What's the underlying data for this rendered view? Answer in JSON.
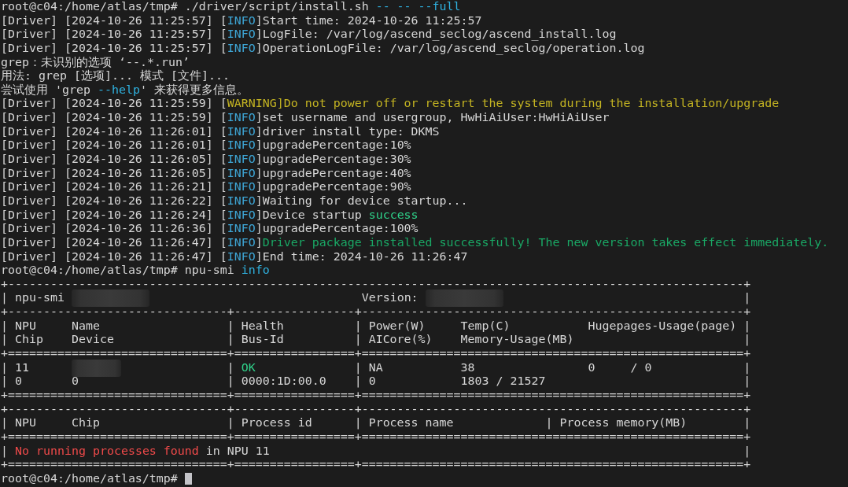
{
  "terminal": {
    "lines": [
      {
        "kind": "prompt",
        "segments": [
          {
            "text": "root@c04:/home/atlas/tmp# ./driver/script/install.sh "
          },
          {
            "kind": "option",
            "text": "-- -- --full"
          }
        ]
      },
      {
        "kind": "log",
        "segments": [
          {
            "text": "[Driver] [2024-10-26 11:25:57] ["
          },
          {
            "kind": "info",
            "text": "INFO"
          },
          {
            "text": "]Start time: 2024-10-26 11:25:57"
          }
        ]
      },
      {
        "kind": "log",
        "segments": [
          {
            "text": "[Driver] [2024-10-26 11:25:57] ["
          },
          {
            "kind": "info",
            "text": "INFO"
          },
          {
            "text": "]LogFile: /var/log/ascend_seclog/ascend_install.log"
          }
        ]
      },
      {
        "kind": "log",
        "segments": [
          {
            "text": "[Driver] [2024-10-26 11:25:57] ["
          },
          {
            "kind": "info",
            "text": "INFO"
          },
          {
            "text": "]OperationLogFile: /var/log/ascend_seclog/operation.log"
          }
        ]
      },
      {
        "kind": "message",
        "segments": [
          {
            "text": "grep：未识别的选项 ‘--.*.run’"
          }
        ]
      },
      {
        "kind": "message",
        "segments": [
          {
            "text": "用法: grep [选项]... 模式 [文件]..."
          }
        ]
      },
      {
        "kind": "message",
        "segments": [
          {
            "text": "尝试使用 'grep "
          },
          {
            "kind": "option",
            "text": "--help"
          },
          {
            "text": "' 来获得更多信息。"
          }
        ]
      },
      {
        "kind": "log",
        "segments": [
          {
            "text": "[Driver] [2024-10-26 11:25:59] ["
          },
          {
            "kind": "warning",
            "text": "WARNING]Do not power off or restart the system during the installation/upgrade"
          }
        ]
      },
      {
        "kind": "log",
        "segments": [
          {
            "text": "[Driver] [2024-10-26 11:25:59] ["
          },
          {
            "kind": "info",
            "text": "INFO"
          },
          {
            "text": "]set username and usergroup, HwHiAiUser:HwHiAiUser"
          }
        ]
      },
      {
        "kind": "log",
        "segments": [
          {
            "text": "[Driver] [2024-10-26 11:26:01] ["
          },
          {
            "kind": "info",
            "text": "INFO"
          },
          {
            "text": "]driver install type: DKMS"
          }
        ]
      },
      {
        "kind": "log",
        "segments": [
          {
            "text": "[Driver] [2024-10-26 11:26:01] ["
          },
          {
            "kind": "info",
            "text": "INFO"
          },
          {
            "text": "]upgradePercentage:10%"
          }
        ]
      },
      {
        "kind": "log",
        "segments": [
          {
            "text": "[Driver] [2024-10-26 11:26:05] ["
          },
          {
            "kind": "info",
            "text": "INFO"
          },
          {
            "text": "]upgradePercentage:30%"
          }
        ]
      },
      {
        "kind": "log",
        "segments": [
          {
            "text": "[Driver] [2024-10-26 11:26:05] ["
          },
          {
            "kind": "info",
            "text": "INFO"
          },
          {
            "text": "]upgradePercentage:40%"
          }
        ]
      },
      {
        "kind": "log",
        "segments": [
          {
            "text": "[Driver] [2024-10-26 11:26:21] ["
          },
          {
            "kind": "info",
            "text": "INFO"
          },
          {
            "text": "]upgradePercentage:90%"
          }
        ]
      },
      {
        "kind": "log",
        "segments": [
          {
            "text": "[Driver] [2024-10-26 11:26:22] ["
          },
          {
            "kind": "info",
            "text": "INFO"
          },
          {
            "text": "]Waiting for device startup..."
          }
        ]
      },
      {
        "kind": "log",
        "segments": [
          {
            "text": "[Driver] [2024-10-26 11:26:24] ["
          },
          {
            "kind": "info",
            "text": "INFO"
          },
          {
            "text": "]Device startup "
          },
          {
            "kind": "ok",
            "text": "success"
          }
        ]
      },
      {
        "kind": "log",
        "segments": [
          {
            "text": "[Driver] [2024-10-26 11:26:36] ["
          },
          {
            "kind": "info",
            "text": "INFO"
          },
          {
            "text": "]upgradePercentage:100%"
          }
        ]
      },
      {
        "kind": "log",
        "segments": [
          {
            "text": "[Driver] [2024-10-26 11:26:47] ["
          },
          {
            "kind": "info",
            "text": "INFO"
          },
          {
            "text": "]"
          },
          {
            "kind": "done",
            "text": "Driver package installed successfully! The new version takes effect immediately."
          }
        ]
      },
      {
        "kind": "log",
        "segments": [
          {
            "text": "[Driver] [2024-10-26 11:26:47] ["
          },
          {
            "kind": "info",
            "text": "INFO"
          },
          {
            "text": "]End time: 2024-10-26 11:26:47"
          }
        ]
      },
      {
        "kind": "prompt",
        "segments": [
          {
            "text": "root@c04:/home/atlas/tmp# npu-smi "
          },
          {
            "kind": "option",
            "text": "info"
          }
        ]
      },
      {
        "kind": "border",
        "segments": [
          {
            "text": "+--------------------------------------------------------------------------------------------------------+"
          }
        ]
      },
      {
        "kind": "banner",
        "segments": [
          {
            "text": "| npu-smi "
          },
          {
            "kind": "redacted"
          },
          {
            "text": "                              Version: "
          },
          {
            "kind": "redacted"
          },
          {
            "text": "                                  |"
          }
        ]
      },
      {
        "kind": "border",
        "segments": [
          {
            "text": "+-------------------------------+-----------------+------------------------------------------------------+"
          }
        ]
      },
      {
        "kind": "row",
        "segments": [
          {
            "text": "| NPU     Name                  | Health          | Power(W)     Temp(C)           Hugepages-Usage(page) |"
          }
        ]
      },
      {
        "kind": "row",
        "segments": [
          {
            "text": "| Chip    Device                | Bus-Id          | AICore(%)    Memory-Usage(MB)                        |"
          }
        ]
      },
      {
        "kind": "border",
        "segments": [
          {
            "text": "+===============================+=================+======================================================+"
          }
        ]
      },
      {
        "kind": "row",
        "segments": [
          {
            "text": "| 11      "
          },
          {
            "kind": "redacted"
          },
          {
            "text": "               | "
          },
          {
            "kind": "ok",
            "text": "OK"
          },
          {
            "text": "              | NA           38                0     / 0             |"
          }
        ]
      },
      {
        "kind": "row",
        "segments": [
          {
            "text": "| 0       0                     | 0000:1D:00.0    | 0            1803 / 21527                            |"
          }
        ]
      },
      {
        "kind": "border",
        "segments": [
          {
            "text": "+===============================+=================+======================================================+"
          }
        ]
      },
      {
        "kind": "border",
        "segments": [
          {
            "text": "+-------------------------------+-----------------+------------------------------------------------------+"
          }
        ]
      },
      {
        "kind": "row",
        "segments": [
          {
            "text": "| NPU     Chip                  | Process id      | Process name             | Process memory(MB)        |"
          }
        ]
      },
      {
        "kind": "border",
        "segments": [
          {
            "text": "+===============================+=================+======================================================+"
          }
        ]
      },
      {
        "kind": "row",
        "segments": [
          {
            "text": "| "
          },
          {
            "kind": "error",
            "text": "No running processes found"
          },
          {
            "text": " in NPU 11                                                                   |"
          }
        ]
      },
      {
        "kind": "border",
        "segments": [
          {
            "text": "+===============================+=================+======================================================+"
          }
        ]
      },
      {
        "kind": "prompt",
        "segments": [
          {
            "text": "root@c04:/home/atlas/tmp# "
          },
          {
            "kind": "cursor"
          }
        ]
      }
    ]
  }
}
